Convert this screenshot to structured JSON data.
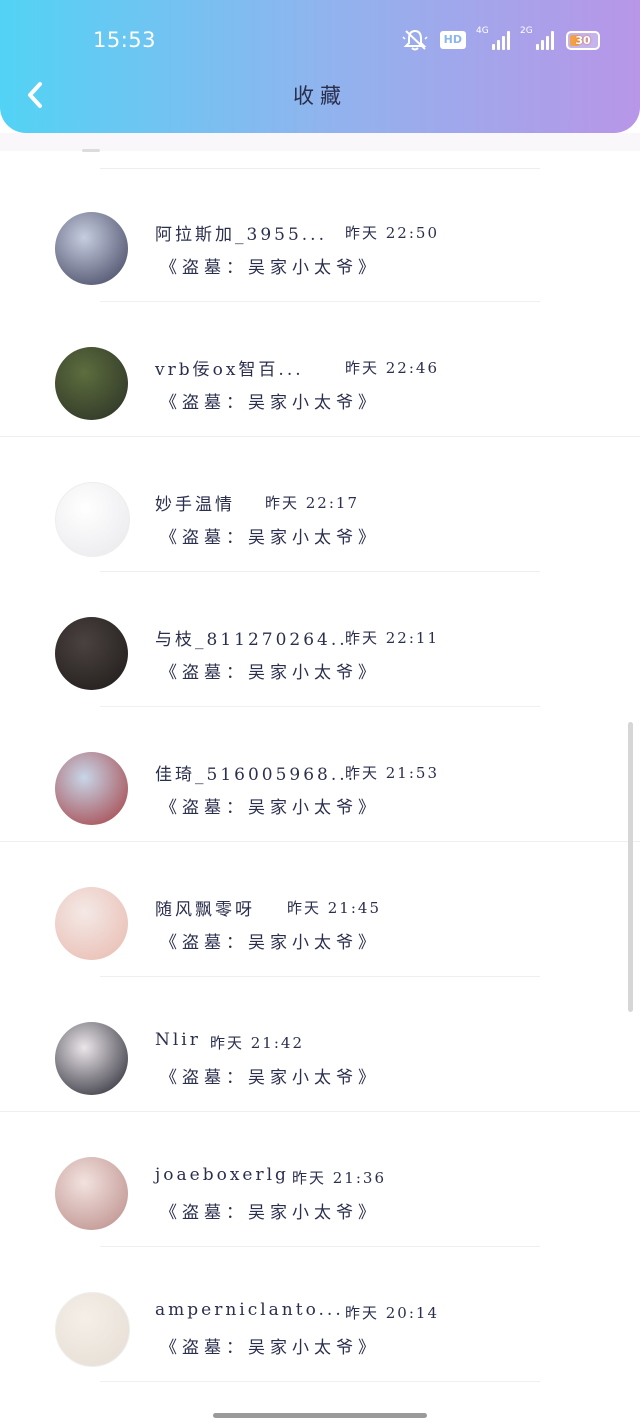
{
  "status_bar": {
    "time": "15:53",
    "hd_label": "HD",
    "signal_1_label": "4G",
    "signal_2_label": "2G",
    "battery": "30"
  },
  "header": {
    "title": "收藏"
  },
  "items": [
    {
      "name": "阿拉斯加_3955...",
      "time": "昨天 22:50",
      "content": "《盗墓：吴家小太爷》",
      "avatar_colors": [
        "#c7cde0",
        "#3b3f5a"
      ]
    },
    {
      "name": "vrb佞ox智百...",
      "time": "昨天 22:46",
      "content": "《盗墓：吴家小太爷》",
      "avatar_colors": [
        "#5d6e3e",
        "#2a2f25"
      ]
    },
    {
      "name": "妙手温情",
      "time": "昨天 22:17",
      "content": "《盗墓：吴家小太爷》",
      "avatar_colors": [
        "#ffffff",
        "#e8e8ec"
      ]
    },
    {
      "name": "与枝_811270264...",
      "time": "昨天 22:11",
      "content": "《盗墓：吴家小太爷》",
      "avatar_colors": [
        "#4a4240",
        "#1e1a19"
      ]
    },
    {
      "name": "佳琦_516005968...",
      "time": "昨天 21:53",
      "content": "《盗墓：吴家小太爷》",
      "avatar_colors": [
        "#c7d6e8",
        "#a33a3e"
      ]
    },
    {
      "name": "随风飘零呀",
      "time": "昨天 21:45",
      "content": "《盗墓：吴家小太爷》",
      "avatar_colors": [
        "#f4e9e6",
        "#e8b9ae"
      ]
    },
    {
      "name": "Nlir",
      "time": "昨天 21:42",
      "content": "《盗墓：吴家小太爷》",
      "avatar_colors": [
        "#ebe6ea",
        "#1f1f2a"
      ]
    },
    {
      "name": "joaeboxerlg",
      "time": "昨天 21:36",
      "content": "《盗墓：吴家小太爷》",
      "avatar_colors": [
        "#f2e2df",
        "#b98a86"
      ]
    },
    {
      "name": "amperniclanto...",
      "time": "昨天 20:14",
      "content": "《盗墓：吴家小太爷》",
      "avatar_colors": [
        "#f5efe8",
        "#e5ddd3"
      ]
    }
  ]
}
